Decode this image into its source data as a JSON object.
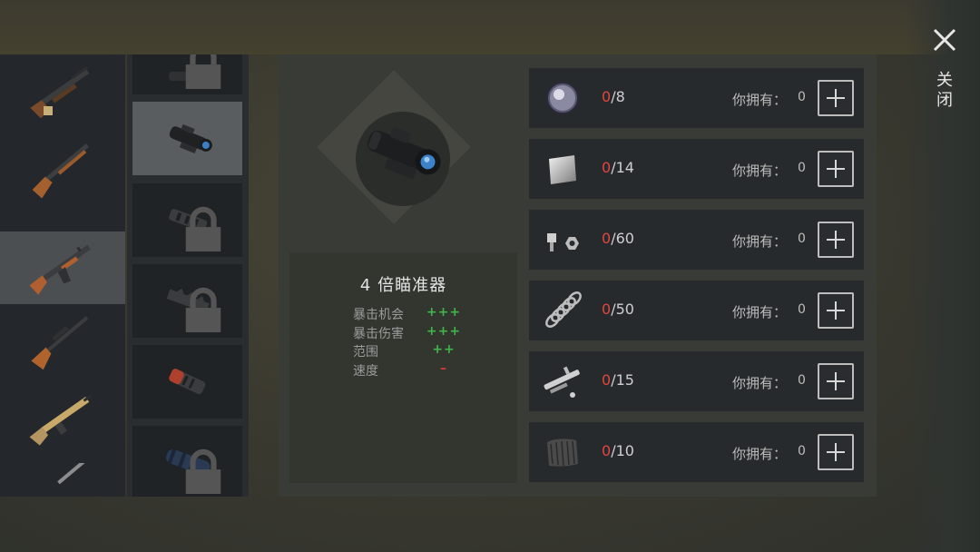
{
  "close": {
    "label": "关闭",
    "icon": "close-x-icon"
  },
  "weapons": [
    {
      "name": "shotgun",
      "icon": "pump-shotgun-icon",
      "selected": false
    },
    {
      "name": "lever-rifle",
      "icon": "lever-rifle-icon",
      "selected": false
    },
    {
      "name": "ak",
      "icon": "assault-rifle-icon",
      "selected": true
    },
    {
      "name": "sniper",
      "icon": "sniper-rifle-icon",
      "selected": false
    },
    {
      "name": "scar",
      "icon": "battle-rifle-icon",
      "selected": false
    }
  ],
  "attachments": [
    {
      "icon": "scope-icon",
      "locked": true,
      "selected": false
    },
    {
      "icon": "4x-scope-icon",
      "locked": false,
      "selected": true
    },
    {
      "icon": "muzzle-brake-icon",
      "locked": true,
      "selected": false
    },
    {
      "icon": "compensator-icon",
      "locked": true,
      "selected": false
    },
    {
      "icon": "red-muzzle-icon",
      "locked": false,
      "selected": false
    },
    {
      "icon": "suppressor-icon",
      "locked": true,
      "selected": false
    }
  ],
  "item": {
    "title": "4 倍瞄准器",
    "icon": "4x-scope-icon",
    "stats": [
      {
        "label": "暴击机会",
        "value": "+++",
        "type": "positive"
      },
      {
        "label": "暴击伤害",
        "value": "+++",
        "type": "positive"
      },
      {
        "label": "范围",
        "value": "++",
        "type": "positive"
      },
      {
        "label": "速度",
        "value": "–",
        "type": "negative"
      }
    ]
  },
  "materials": [
    {
      "icon": "lens-icon",
      "have": "0",
      "need": "/8",
      "own_label": "你拥有：",
      "own_value": "0"
    },
    {
      "icon": "metal-sheet-icon",
      "have": "0",
      "need": "/14",
      "own_label": "你拥有：",
      "own_value": "0"
    },
    {
      "icon": "bolt-nut-icon",
      "have": "0",
      "need": "/60",
      "own_label": "你拥有：",
      "own_value": "0"
    },
    {
      "icon": "spring-icon",
      "have": "0",
      "need": "/50",
      "own_label": "你拥有：",
      "own_value": "0"
    },
    {
      "icon": "gun-parts-icon",
      "have": "0",
      "need": "/15",
      "own_label": "你拥有：",
      "own_value": "0"
    },
    {
      "icon": "carbon-fiber-icon",
      "have": "0",
      "need": "/10",
      "own_label": "你拥有：",
      "own_value": "0"
    }
  ]
}
